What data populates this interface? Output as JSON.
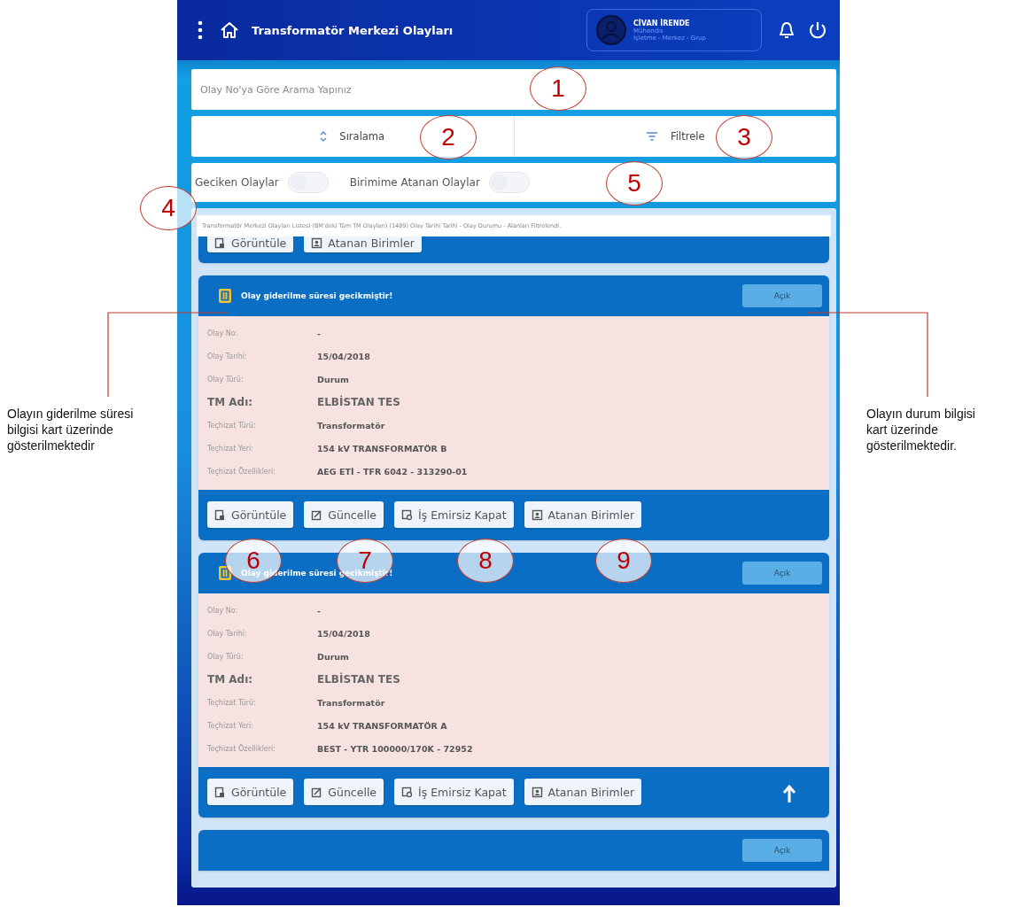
{
  "app_bar": {
    "title": "Transformatör Merkezi Olayları",
    "user": {
      "name": "CİVAN İRENDE",
      "role": "Mühendis",
      "unit": "İşletme - Merkez - Grup"
    }
  },
  "search": {
    "placeholder": "Olay No'ya Göre Arama Yapınız"
  },
  "actions": [
    {
      "kind": "sort",
      "label": "Sıralama"
    },
    {
      "kind": "filter",
      "label": "Filtrele"
    }
  ],
  "toggles": [
    {
      "label": "Geciken Olaylar",
      "on": false
    },
    {
      "label": "Birimime Atanan Olaylar",
      "on": false
    }
  ],
  "list_info": "Transformatör Merkezi Olayları Listesi (BM'deki Tüm TM Olayları) (1489) Olay Tarihi Tarihi - Olay Durumu - Alanları Filtrelendi.",
  "cards": [
    {
      "buttons": [
        {
          "kind": "view",
          "label": "Görüntüle"
        },
        {
          "kind": "units",
          "label": "Atanan Birimler"
        }
      ]
    },
    {
      "warning": "Olay giderilme süresi gecikmiştir!",
      "status": "Açık",
      "fields": [
        {
          "label": "Olay No:",
          "value": "-",
          "kind": "normal"
        },
        {
          "label": "Olay Tarihi:",
          "value": "15/04/2018",
          "kind": "normal"
        },
        {
          "label": "Olay Türü:",
          "value": "Durum",
          "kind": "normal"
        },
        {
          "label": "TM Adı:",
          "value": "ELBİSTAN TES",
          "kind": "highlight"
        },
        {
          "label": "Teçhizat Türü:",
          "value": "Transformatör",
          "kind": "normal"
        },
        {
          "label": "Teçhizat Yeri:",
          "value": "154 kV TRANSFORMATÖR B",
          "kind": "normal"
        },
        {
          "label": "Teçhizat Özellikleri:",
          "value": "AEG ETİ - TFR 6042 - 313290-01",
          "kind": "normal"
        }
      ],
      "buttons": [
        {
          "kind": "view",
          "label": "Görüntüle"
        },
        {
          "kind": "edit",
          "label": "Güncelle"
        },
        {
          "kind": "close",
          "label": "İş Emirsiz Kapat"
        },
        {
          "kind": "units",
          "label": "Atanan Birimler"
        }
      ]
    },
    {
      "warning": "Olay giderilme süresi gecikmiştir!",
      "status": "Açık",
      "fields": [
        {
          "label": "Olay No:",
          "value": "-",
          "kind": "normal"
        },
        {
          "label": "Olay Tarihi:",
          "value": "15/04/2018",
          "kind": "normal"
        },
        {
          "label": "Olay Türü:",
          "value": "Durum",
          "kind": "normal"
        },
        {
          "label": "TM Adı:",
          "value": "ELBİSTAN TES",
          "kind": "highlight"
        },
        {
          "label": "Teçhizat Türü:",
          "value": "Transformatör",
          "kind": "normal"
        },
        {
          "label": "Teçhizat Yeri:",
          "value": "154 kV TRANSFORMATÖR A",
          "kind": "normal"
        },
        {
          "label": "Teçhizat Özellikleri:",
          "value": "BEST - YTR 100000/170K - 72952",
          "kind": "normal"
        }
      ],
      "buttons": [
        {
          "kind": "view",
          "label": "Görüntüle"
        },
        {
          "kind": "edit",
          "label": "Güncelle"
        },
        {
          "kind": "close",
          "label": "İş Emirsiz Kapat"
        },
        {
          "kind": "units",
          "label": "Atanan Birimler"
        }
      ]
    },
    {
      "status": "Açık"
    }
  ],
  "annotations": {
    "markers": [
      "1",
      "2",
      "3",
      "4",
      "5",
      "6",
      "7",
      "8",
      "9"
    ],
    "left_callout": "Olayın giderilme süresi bilgisi kart üzerinde gösterilmektedir",
    "right_callout": "Olayın durum bilgisi kart üzerinde gösterilmektedir."
  }
}
